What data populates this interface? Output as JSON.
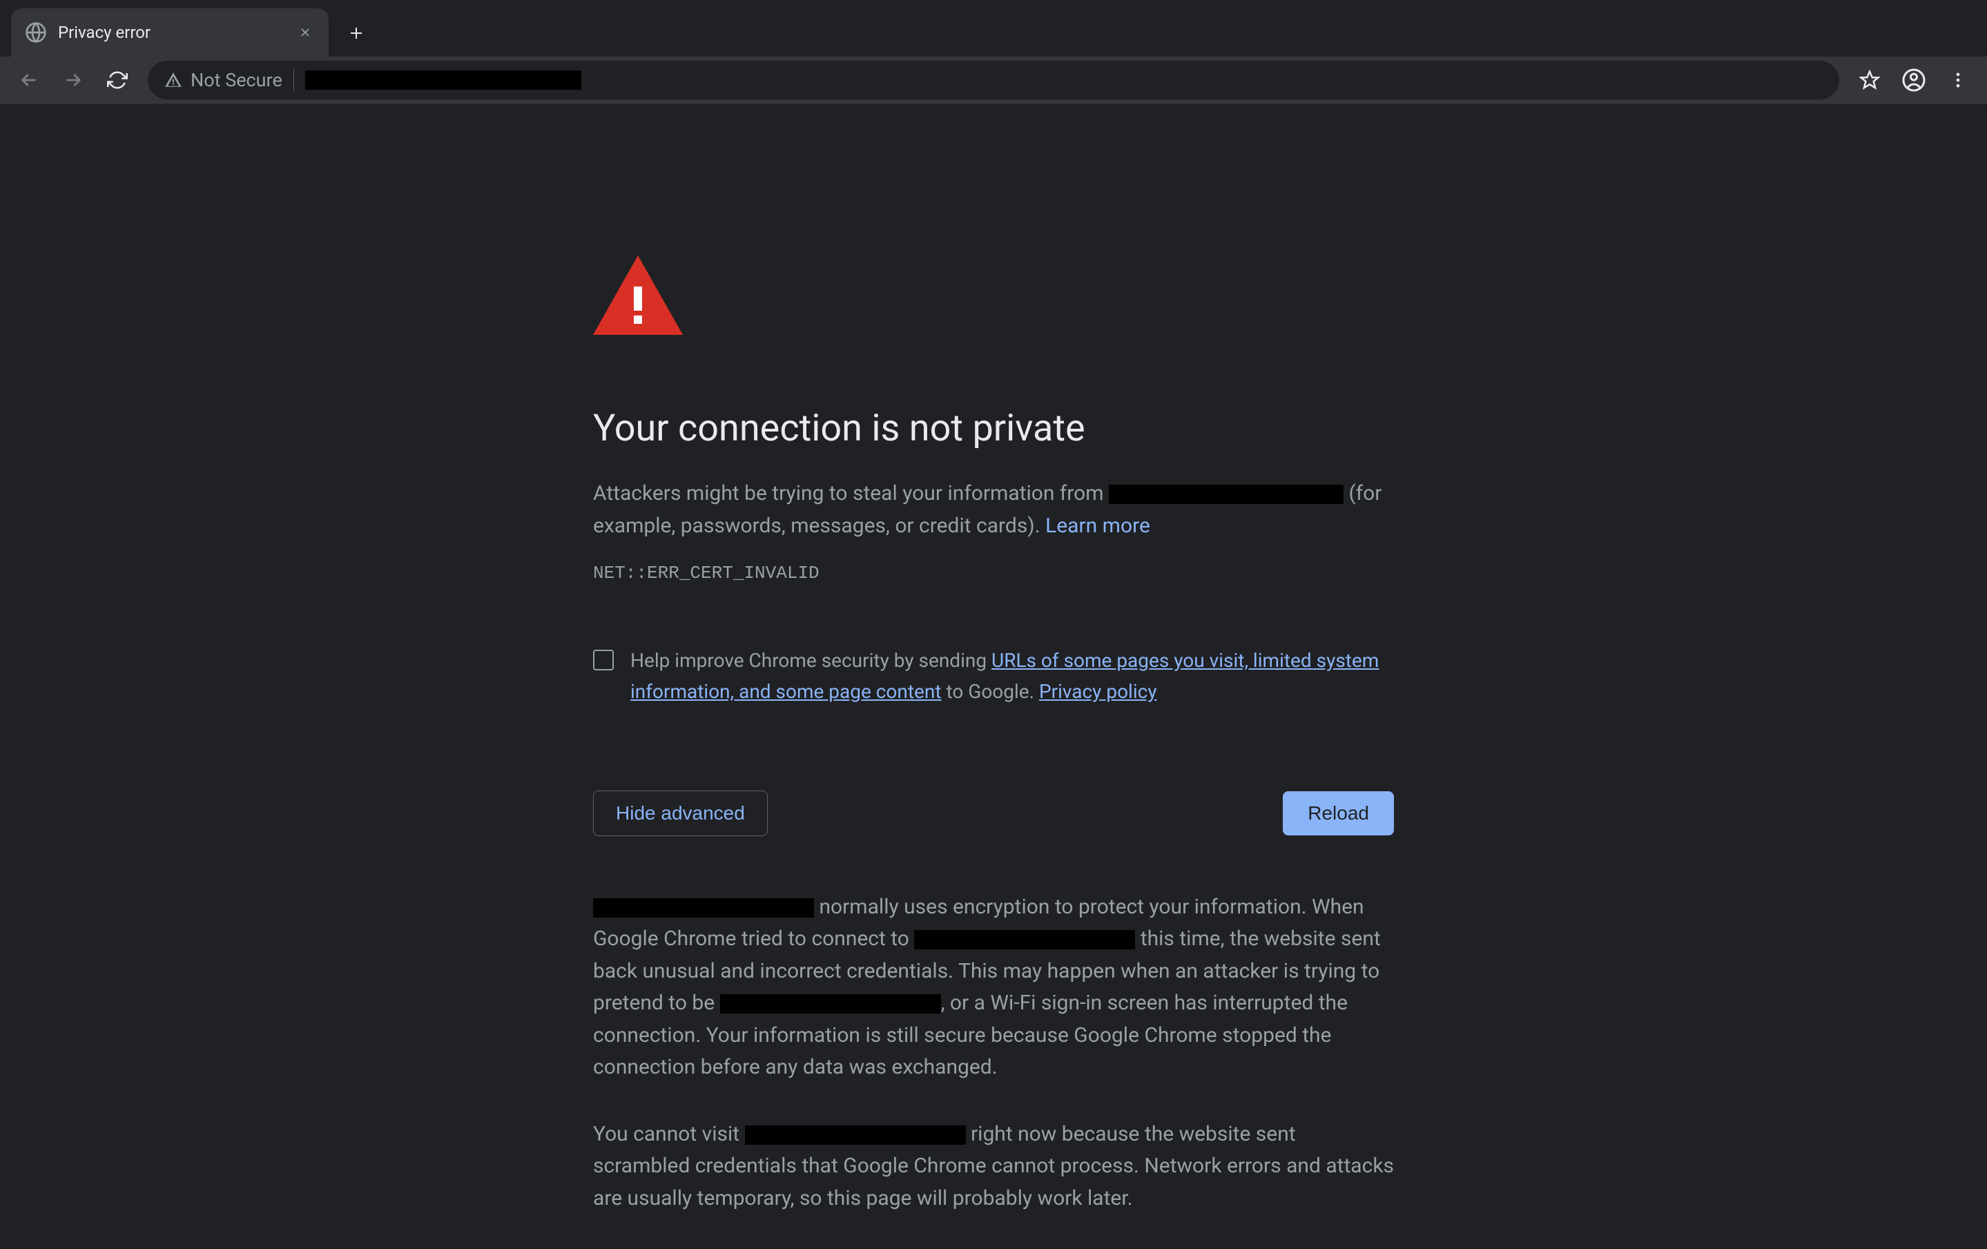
{
  "tab": {
    "title": "Privacy error"
  },
  "toolbar": {
    "security_label": "Not Secure"
  },
  "error": {
    "heading": "Your connection is not private",
    "para1_pre": "Attackers might be trying to steal your information from ",
    "para1_post": " (for example, passwords, messages, or credit cards). ",
    "learn_more": "Learn more",
    "error_code": "NET::ERR_CERT_INVALID",
    "opt_in_pre": "Help improve Chrome security by sending ",
    "opt_in_link1": "URLs of some pages you visit, limited system information, and some page content",
    "opt_in_mid": " to Google. ",
    "opt_in_link2": "Privacy policy",
    "hide_advanced": "Hide advanced",
    "reload": "Reload",
    "adv_p1_a": " normally uses encryption to protect your information. When Google Chrome tried to connect to ",
    "adv_p1_b": " this time, the website sent back unusual and incorrect credentials. This may happen when an attacker is trying to pretend to be ",
    "adv_p1_c": ", or a Wi-Fi sign-in screen has interrupted the connection. Your information is still secure because Google Chrome stopped the connection before any data was exchanged.",
    "adv_p2_a": "You cannot visit ",
    "adv_p2_b": " right now because the website sent scrambled credentials that Google Chrome cannot process. Network errors and attacks are usually temporary, so this page will probably work later."
  }
}
